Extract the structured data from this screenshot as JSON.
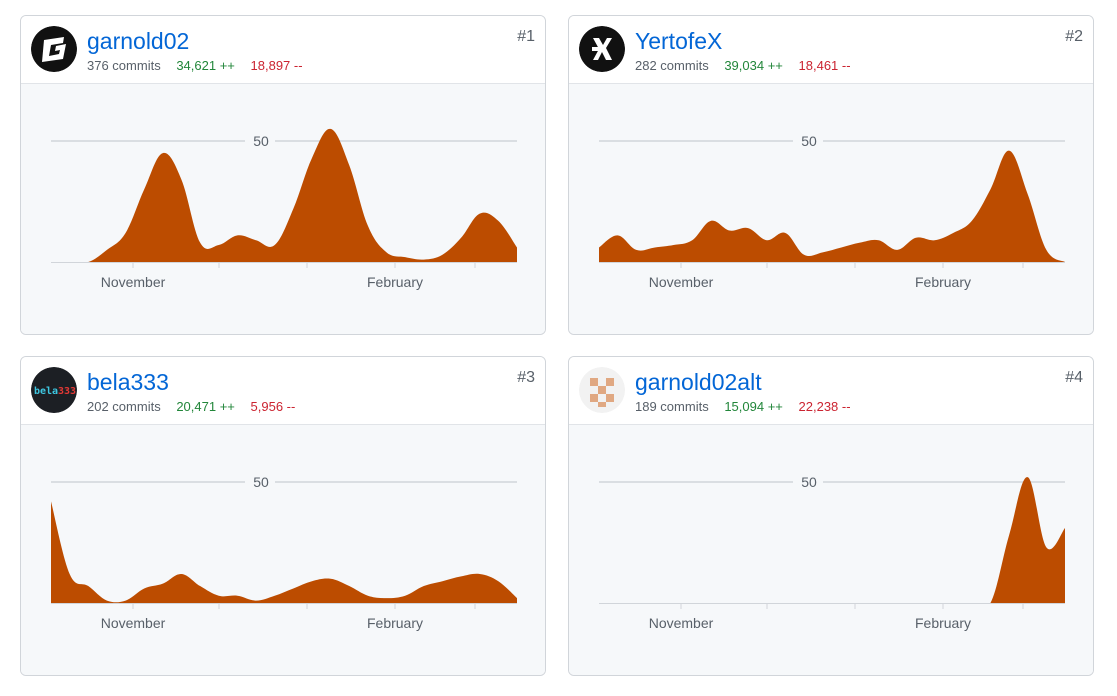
{
  "reference_label": "50",
  "x_axis_labels": [
    "November",
    "February"
  ],
  "contributors": [
    {
      "rank": "#1",
      "username": "garnold02",
      "commits": "376 commits",
      "additions": "34,621 ++",
      "deletions": "18,897 --",
      "avatar_icon": "g-logo-avatar-icon",
      "chart_data": {
        "type": "area",
        "reference_line": 50,
        "x_labels": [
          "November",
          "February"
        ],
        "x": [
          0,
          4,
          8,
          12,
          16,
          20,
          24,
          28,
          32,
          36,
          40,
          44,
          48,
          52,
          56,
          60,
          64,
          68,
          72,
          76,
          80,
          84,
          88,
          92,
          96,
          100
        ],
        "y": [
          0,
          0,
          0,
          5,
          12,
          30,
          45,
          34,
          8,
          7,
          11,
          9,
          7,
          22,
          43,
          55,
          40,
          15,
          4,
          2,
          1,
          3,
          10,
          20,
          17,
          6
        ]
      }
    },
    {
      "rank": "#2",
      "username": "YertofeX",
      "commits": "282 commits",
      "additions": "39,034 ++",
      "deletions": "18,461 --",
      "avatar_icon": "x-logo-avatar-icon",
      "chart_data": {
        "type": "area",
        "reference_line": 50,
        "x_labels": [
          "November",
          "February"
        ],
        "x": [
          0,
          4,
          8,
          12,
          16,
          20,
          24,
          28,
          32,
          36,
          40,
          44,
          48,
          52,
          56,
          60,
          64,
          68,
          72,
          76,
          80,
          84,
          88,
          92,
          96,
          100
        ],
        "y": [
          6,
          11,
          5,
          6,
          7,
          9,
          17,
          13,
          14,
          9,
          12,
          3,
          4,
          6,
          8,
          9,
          5,
          10,
          9,
          12,
          17,
          30,
          46,
          28,
          5,
          0
        ]
      }
    },
    {
      "rank": "#3",
      "username": "bela333",
      "commits": "202 commits",
      "additions": "20,471 ++",
      "deletions": "5,956 --",
      "avatar_icon": "bela333-logo-avatar-icon",
      "chart_data": {
        "type": "area",
        "reference_line": 50,
        "x_labels": [
          "November",
          "February"
        ],
        "x": [
          0,
          4,
          8,
          12,
          16,
          20,
          24,
          28,
          32,
          36,
          40,
          44,
          48,
          52,
          56,
          60,
          64,
          68,
          72,
          76,
          80,
          84,
          88,
          92,
          96,
          100
        ],
        "y": [
          42,
          12,
          7,
          1,
          1,
          6,
          8,
          12,
          7,
          3,
          3,
          1,
          3,
          6,
          9,
          10,
          7,
          3,
          2,
          3,
          7,
          9,
          11,
          12,
          9,
          2
        ]
      }
    },
    {
      "rank": "#4",
      "username": "garnold02alt",
      "commits": "189 commits",
      "additions": "15,094 ++",
      "deletions": "22,238 --",
      "avatar_icon": "pixel-face-avatar-icon",
      "chart_data": {
        "type": "area",
        "reference_line": 50,
        "x_labels": [
          "November",
          "February"
        ],
        "x": [
          0,
          4,
          8,
          12,
          16,
          20,
          24,
          28,
          32,
          36,
          40,
          44,
          48,
          52,
          56,
          60,
          64,
          68,
          72,
          76,
          80,
          84,
          88,
          92,
          96,
          100
        ],
        "y": [
          0,
          0,
          0,
          0,
          0,
          0,
          0,
          0,
          0,
          0,
          0,
          0,
          0,
          0,
          0,
          0,
          0,
          0,
          0,
          0,
          0,
          0,
          28,
          52,
          23,
          31
        ]
      }
    }
  ]
}
